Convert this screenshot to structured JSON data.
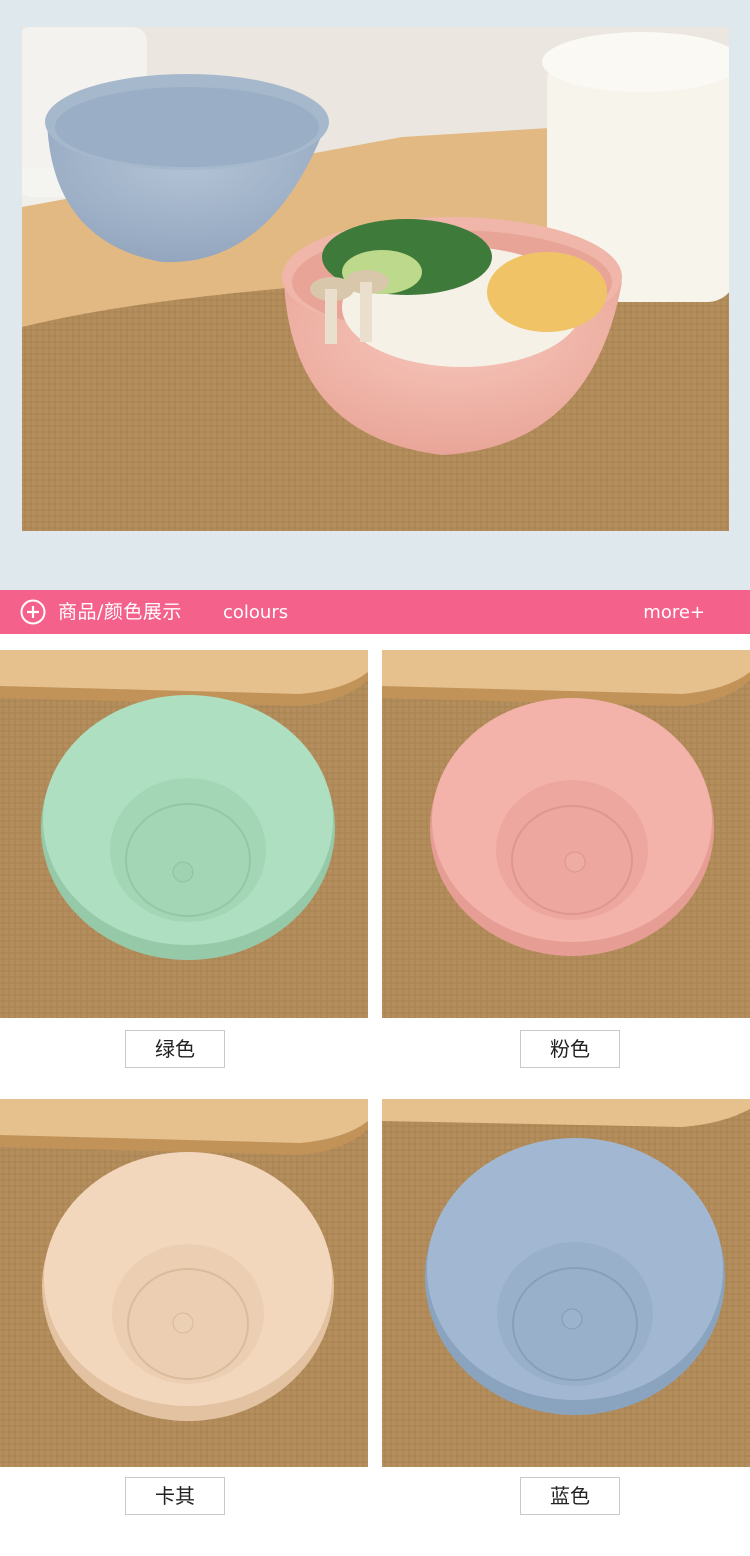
{
  "hero": {
    "image": "bowls-with-rice-on-burlap-photo",
    "colors": {
      "band": "#dfe8ec",
      "burlap": "#b58e5e"
    }
  },
  "section": {
    "icon": "plus-circle-icon",
    "title": "商品/颜色展示",
    "subtitle": "colours",
    "more": "more+",
    "color": "#f4628c"
  },
  "swatches": [
    {
      "label": "绿色",
      "bowl_color": "#a9dcbc",
      "image": "green-bowl-photo"
    },
    {
      "label": "粉色",
      "bowl_color": "#f2b1a8",
      "image": "pink-bowl-photo"
    },
    {
      "label": "卡其",
      "bowl_color": "#f0d4bb",
      "image": "khaki-bowl-photo"
    },
    {
      "label": "蓝色",
      "bowl_color": "#9fb5cf",
      "image": "blue-bowl-photo"
    }
  ]
}
